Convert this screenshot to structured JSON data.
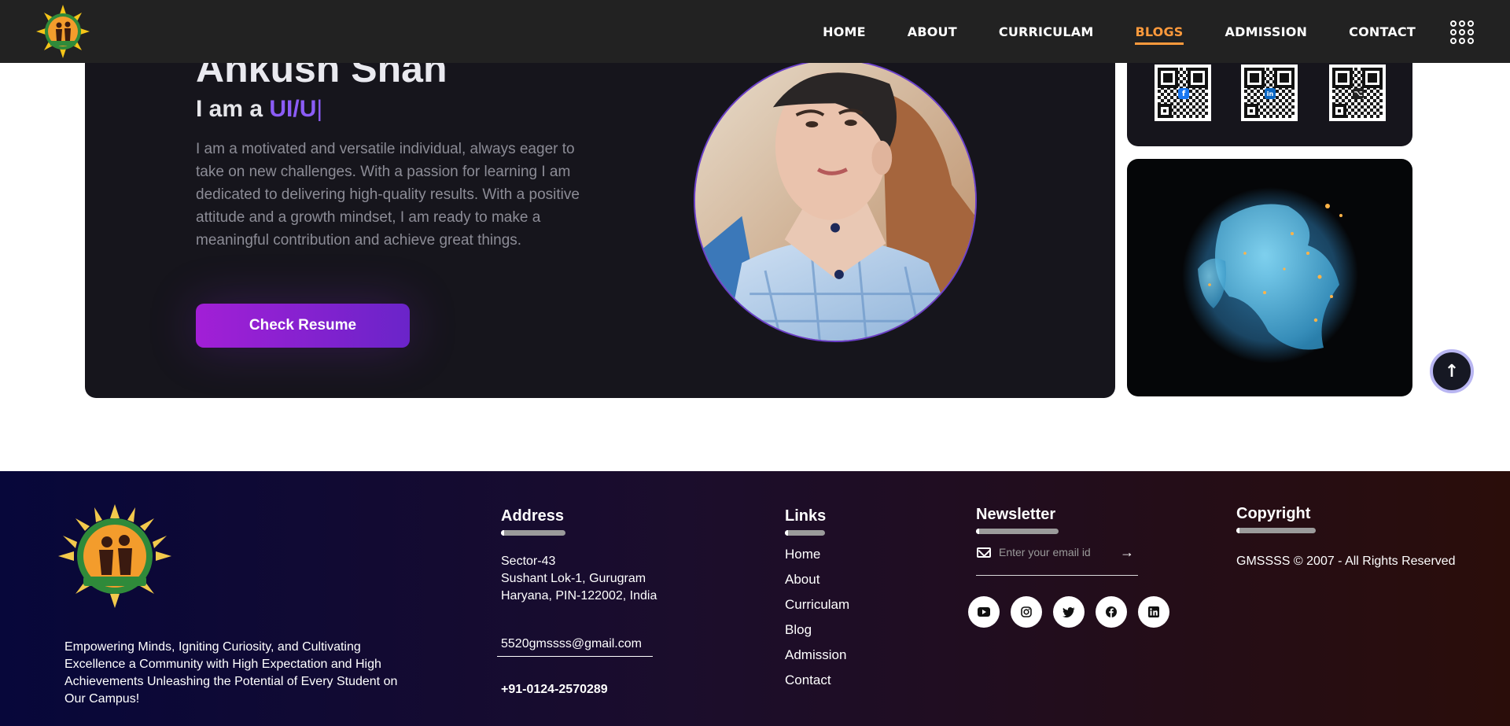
{
  "nav": {
    "logo_icon": "school-emblem-icon",
    "items": [
      {
        "label": "HOME",
        "active": false
      },
      {
        "label": "ABOUT",
        "active": false
      },
      {
        "label": "CURRICULAM",
        "active": false
      },
      {
        "label": "BLOGS",
        "active": true
      },
      {
        "label": "ADMISSION",
        "active": false
      },
      {
        "label": "CONTACT",
        "active": false
      }
    ],
    "menu_icon": "apps-grid-icon",
    "active_color": "#ff9a3c"
  },
  "hero": {
    "name": "Ankush Shah",
    "role_prefix": "I am a ",
    "role_typed": "UI/U",
    "description": "I am a motivated and versatile individual, always eager to take on new challenges. With a passion for learning I am dedicated to delivering high-quality results. With a positive attitude and a growth mindset, I am ready to make a meaningful contribution and achieve great things.",
    "resume_button": "Check Resume",
    "accent_color": "#8b5cf6"
  },
  "side": {
    "qr_codes": [
      {
        "icon": "facebook-icon",
        "glyph": "f"
      },
      {
        "icon": "linkedin-icon",
        "glyph": "in"
      },
      {
        "icon": "github-icon",
        "glyph": "⌥"
      }
    ],
    "globe_icon": "glowing-globe-image"
  },
  "scroll_top_icon": "arrow-up-icon",
  "footer": {
    "about": "Empowering Minds, Igniting Curiosity, and Cultivating Excellence a Community with High Expectation and High Achievements Unleashing the Potential of Every Student on Our Campus!",
    "address": {
      "heading": "Address",
      "line1": "Sector-43",
      "line2": "Sushant Lok-1, Gurugram",
      "line3": "Haryana, PIN-122002, India",
      "email": "5520gmssss@gmail.com",
      "phone": "+91-0124-2570289"
    },
    "links": {
      "heading": "Links",
      "items": [
        "Home",
        "About",
        "Curriculam",
        "Blog",
        "Admission",
        "Contact"
      ]
    },
    "newsletter": {
      "heading": "Newsletter",
      "placeholder": "Enter your email id",
      "socials": [
        "youtube-icon",
        "instagram-icon",
        "twitter-icon",
        "facebook-icon",
        "linkedin-icon"
      ]
    },
    "copyright": {
      "heading": "Copyright",
      "text": "GMSSSS © 2007 - All Rights Reserved"
    }
  }
}
